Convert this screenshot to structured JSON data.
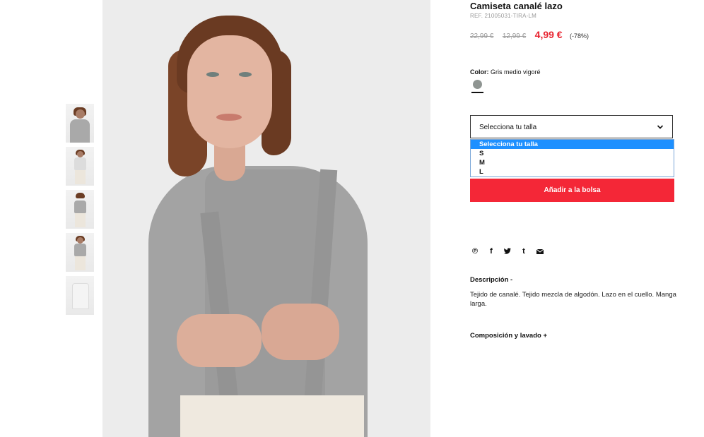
{
  "product": {
    "title": "Camiseta canalé lazo",
    "ref": "REF. 21005031-TIRA-LM",
    "price_old_1": "22,99 €",
    "price_old_2": "12,99 €",
    "price_new": "4,99 €",
    "discount": "(-78%)"
  },
  "color": {
    "label": "Color:",
    "value": "Gris medio vigoré",
    "swatch_color": "#8f9592"
  },
  "size_select": {
    "label": "Selecciona tu talla",
    "options": [
      "Selecciona tu talla",
      "S",
      "M",
      "L"
    ],
    "selected_index": 0
  },
  "add_to_bag": "Añadir a la bolsa",
  "share_icons": [
    "pinterest-icon",
    "facebook-icon",
    "twitter-icon",
    "tumblr-icon",
    "email-icon"
  ],
  "share_glyphs": {
    "pinterest": "℗",
    "facebook": "f",
    "tumblr": "t"
  },
  "description": {
    "heading": "Descripción  -",
    "text": "Tejido de canalé. Tejido mezcla de algodón. Lazo en el cuello. Manga larga."
  },
  "composition": {
    "heading": "Composición y lavado  +"
  },
  "colors": {
    "accent_red": "#f42737",
    "price_red": "#e8232f",
    "dropdown_highlight": "#1e90ff"
  }
}
